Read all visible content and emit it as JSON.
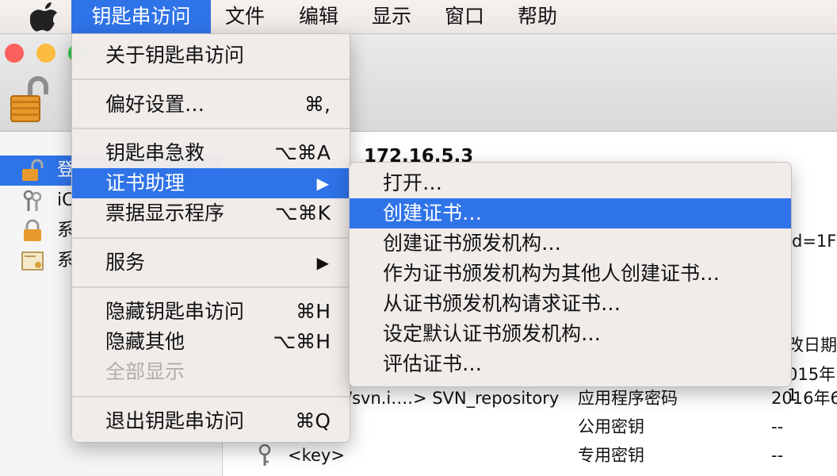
{
  "menubar": {
    "items": [
      "钥匙串访问",
      "文件",
      "编辑",
      "显示",
      "窗口",
      "帮助"
    ]
  },
  "app_menu": {
    "about": "关于钥匙串访问",
    "prefs": {
      "label": "偏好设置…",
      "shortcut": "⌘,"
    },
    "first_aid": {
      "label": "钥匙串急救",
      "shortcut": "⌥⌘A"
    },
    "cert_assistant": {
      "label": "证书助理",
      "arrow": "▶"
    },
    "ticket_viewer": {
      "label": "票据显示程序",
      "shortcut": "⌥⌘K"
    },
    "services": {
      "label": "服务",
      "arrow": "▶"
    },
    "hide": {
      "label": "隐藏钥匙串访问",
      "shortcut": "⌘H"
    },
    "hide_others": {
      "label": "隐藏其他",
      "shortcut": "⌥⌘H"
    },
    "show_all": "全部显示",
    "quit": {
      "label": "退出钥匙串访问",
      "shortcut": "⌘Q"
    }
  },
  "cert_submenu": {
    "items": [
      "打开…",
      "创建证书…",
      "创建证书颁发机构…",
      "作为证书颁发机构为其他人创建证书…",
      "从证书颁发机构请求证书…",
      "设定默认证书颁发机构…",
      "评估证书…"
    ]
  },
  "sidebar": {
    "items": [
      "登",
      "iC",
      "系",
      "系"
    ]
  },
  "detail": {
    "title": "172.16.5.3",
    "right_snippet": "d=1F",
    "col_date_header": "改日期",
    "hl_date": "015年1"
  },
  "rows": [
    {
      "name": "/svn.i….> SVN_repository",
      "kind": "应用程序密码",
      "date": "2016年6"
    },
    {
      "name": "",
      "kind": "公用密钥",
      "date": "--"
    },
    {
      "name": "<key>",
      "kind": "专用密钥",
      "date": "--"
    }
  ],
  "colors": {
    "accent": "#2f73e8",
    "close": "#fc605c",
    "minimize": "#fdbc40",
    "zoom": "#34c84a"
  }
}
